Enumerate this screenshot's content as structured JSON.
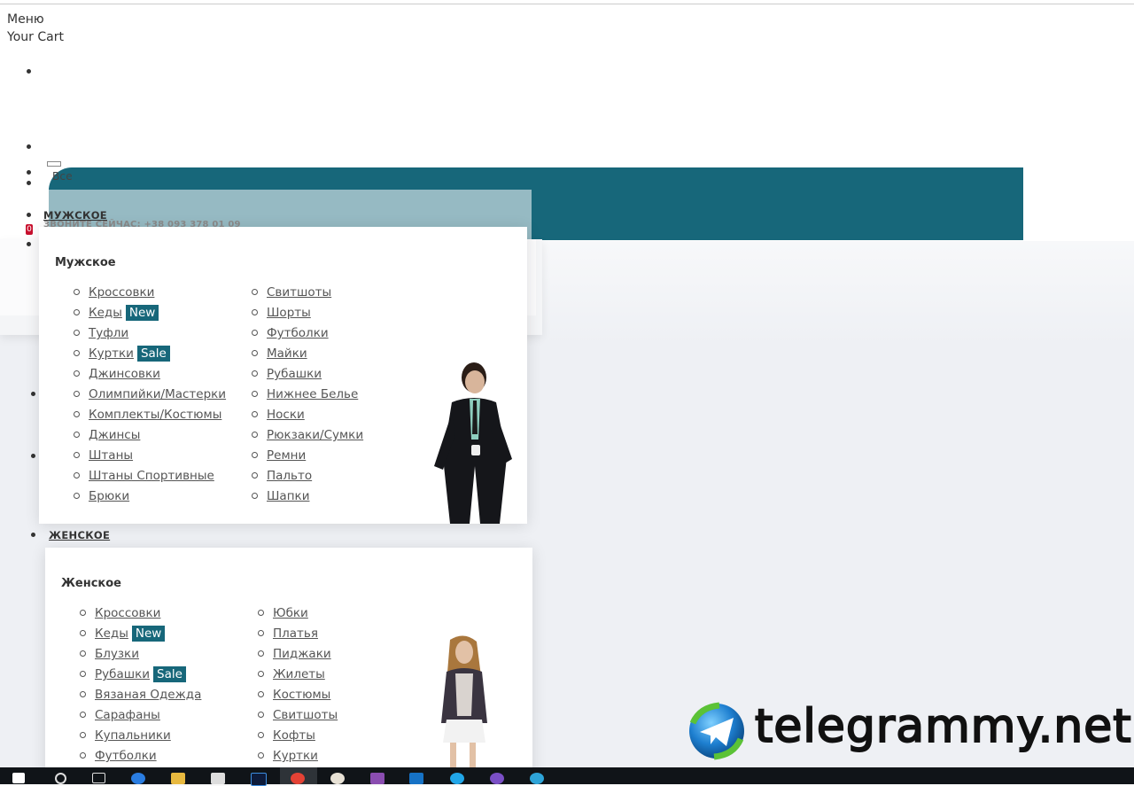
{
  "header": {
    "menu_label": "Меню",
    "cart_label": "Your Cart",
    "cart_count": "0"
  },
  "nav": {
    "mens_label": "МУЖСКОЕ",
    "womens_label": "ЖЕНСКОЕ",
    "ghost_phone": "ЗВОНИТЕ СЕЙЧАС: +38 093 378 01 09",
    "ghost_all": "Все"
  },
  "icons": {
    "placeholder_glyph": ""
  },
  "mens": {
    "title": "Мужское",
    "left": [
      {
        "label": "Кроссовки"
      },
      {
        "label": "Кеды",
        "badge": "New"
      },
      {
        "label": "Туфли"
      },
      {
        "label": "Куртки",
        "badge": "Sale"
      },
      {
        "label": "Джинсовки"
      },
      {
        "label": "Олимпийки/Мастерки"
      },
      {
        "label": "Комплекты/Костюмы"
      },
      {
        "label": "Джинсы"
      },
      {
        "label": "Штаны"
      },
      {
        "label": "Штаны Спортивные"
      },
      {
        "label": "Брюки"
      }
    ],
    "right": [
      {
        "label": "Свитшоты"
      },
      {
        "label": "Шорты"
      },
      {
        "label": "Футболки"
      },
      {
        "label": "Майки"
      },
      {
        "label": "Рубашки"
      },
      {
        "label": "Нижнее Белье"
      },
      {
        "label": "Носки"
      },
      {
        "label": "Рюкзаки/Сумки"
      },
      {
        "label": "Ремни"
      },
      {
        "label": "Пальто"
      },
      {
        "label": "Шапки"
      }
    ]
  },
  "womens": {
    "title": "Женское",
    "left": [
      {
        "label": "Кроссовки"
      },
      {
        "label": "Кеды",
        "badge": "New"
      },
      {
        "label": "Блузки"
      },
      {
        "label": "Рубашки",
        "badge": "Sale"
      },
      {
        "label": "Вязаная Одежда"
      },
      {
        "label": "Сарафаны"
      },
      {
        "label": "Купальники"
      },
      {
        "label": "Футболки"
      }
    ],
    "right": [
      {
        "label": "Юбки"
      },
      {
        "label": "Платья"
      },
      {
        "label": "Пиджаки"
      },
      {
        "label": "Жилеты"
      },
      {
        "label": "Костюмы"
      },
      {
        "label": "Свитшоты"
      },
      {
        "label": "Кофты"
      },
      {
        "label": "Куртки"
      }
    ]
  },
  "watermark": {
    "text": "telegrammy.net"
  },
  "colors": {
    "accent": "#17677a",
    "background": "#eef0f4",
    "badge_red": "#c8102e"
  }
}
